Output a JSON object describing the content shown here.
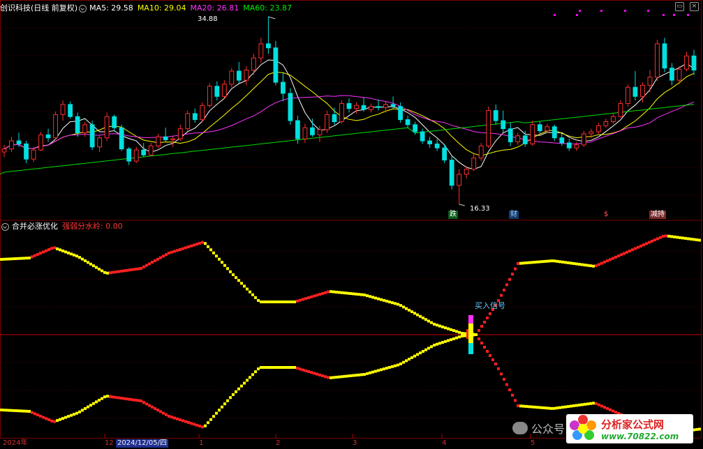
{
  "header": {
    "stock_title": "创识科技(日线 前复权)",
    "ma5": "MA5: 29.58",
    "ma10": "MA10: 29.04",
    "ma20": "MA20: 26.81",
    "ma60": "MA60: 23.87",
    "colors": {
      "ma5": "#ffffff",
      "ma10": "#ffff00",
      "ma20": "#ff33ff",
      "ma60": "#00e000"
    }
  },
  "price_labels": {
    "high": "34.88",
    "low": "16.33"
  },
  "event_badges": [
    "跌",
    "财",
    "$",
    "减持"
  ],
  "indicator": {
    "name": "合并必涨优化",
    "param": "强弱分水岭: 0.00",
    "buy_signal": "买入信号"
  },
  "xaxis": {
    "labels": [
      "2024年",
      "12",
      "1",
      "2",
      "3",
      "4",
      "5"
    ],
    "cursor_date": "2024/12/05/四"
  },
  "watermark": {
    "wechat": "公众号",
    "site_title": "分析家公式网",
    "site_url": "www.70822.com"
  },
  "chart_data": {
    "type": "candlestick",
    "candles": [
      [
        21.5,
        22.2,
        21.0,
        21.8
      ],
      [
        21.8,
        23.0,
        21.5,
        22.6
      ],
      [
        22.6,
        23.4,
        22.0,
        22.3
      ],
      [
        22.3,
        22.6,
        20.4,
        20.8
      ],
      [
        20.8,
        22.0,
        20.5,
        21.7
      ],
      [
        21.7,
        23.5,
        21.6,
        23.2
      ],
      [
        23.2,
        23.8,
        22.5,
        22.9
      ],
      [
        22.9,
        25.5,
        22.7,
        25.2
      ],
      [
        25.2,
        26.6,
        24.6,
        26.2
      ],
      [
        26.2,
        26.5,
        24.8,
        25.0
      ],
      [
        25.0,
        25.4,
        23.0,
        23.4
      ],
      [
        23.4,
        24.5,
        23.0,
        24.2
      ],
      [
        24.2,
        24.6,
        21.7,
        22.0
      ],
      [
        22.0,
        23.2,
        21.5,
        22.9
      ],
      [
        22.9,
        25.4,
        22.6,
        25.0
      ],
      [
        25.0,
        25.2,
        23.6,
        23.9
      ],
      [
        23.9,
        24.2,
        21.6,
        21.8
      ],
      [
        21.8,
        22.0,
        20.2,
        20.6
      ],
      [
        20.6,
        22.0,
        20.4,
        21.7
      ],
      [
        21.7,
        22.4,
        21.0,
        21.2
      ],
      [
        21.2,
        22.4,
        21.1,
        22.1
      ],
      [
        22.1,
        23.3,
        21.9,
        23.0
      ],
      [
        23.0,
        23.9,
        22.5,
        22.7
      ],
      [
        22.7,
        23.1,
        22.0,
        22.8
      ],
      [
        22.8,
        24.2,
        22.6,
        23.8
      ],
      [
        23.8,
        25.6,
        23.6,
        25.3
      ],
      [
        25.3,
        25.8,
        24.4,
        24.7
      ],
      [
        24.7,
        26.4,
        24.5,
        26.1
      ],
      [
        26.1,
        28.3,
        25.9,
        28.0
      ],
      [
        28.0,
        28.5,
        26.6,
        27.0
      ],
      [
        27.0,
        28.6,
        26.8,
        28.2
      ],
      [
        28.2,
        29.8,
        27.9,
        29.5
      ],
      [
        29.5,
        30.4,
        28.3,
        28.6
      ],
      [
        28.6,
        30.0,
        28.1,
        29.6
      ],
      [
        29.6,
        31.2,
        29.1,
        30.8
      ],
      [
        30.8,
        32.8,
        30.3,
        32.2
      ],
      [
        32.2,
        34.88,
        31.2,
        31.8
      ],
      [
        31.8,
        32.5,
        28.1,
        28.4
      ],
      [
        28.4,
        29.3,
        26.5,
        27.3
      ],
      [
        27.3,
        27.8,
        24.2,
        24.6
      ],
      [
        24.6,
        25.1,
        22.3,
        22.8
      ],
      [
        22.8,
        24.3,
        22.4,
        23.9
      ],
      [
        23.9,
        24.8,
        23.0,
        23.2
      ],
      [
        23.2,
        24.1,
        22.5,
        23.7
      ],
      [
        23.7,
        25.6,
        23.4,
        25.2
      ],
      [
        25.2,
        25.9,
        24.2,
        24.5
      ],
      [
        24.5,
        26.6,
        24.3,
        26.3
      ],
      [
        26.3,
        26.8,
        25.4,
        25.8
      ],
      [
        25.8,
        26.4,
        25.3,
        26.1
      ],
      [
        26.1,
        26.9,
        25.5,
        25.7
      ],
      [
        25.7,
        26.3,
        25.4,
        26.0
      ],
      [
        26.0,
        26.7,
        25.6,
        25.9
      ],
      [
        25.9,
        26.5,
        25.4,
        26.2
      ],
      [
        26.2,
        27.0,
        25.8,
        26.0
      ],
      [
        26.0,
        26.4,
        24.4,
        24.7
      ],
      [
        24.7,
        25.1,
        23.9,
        24.2
      ],
      [
        24.2,
        24.5,
        23.2,
        23.5
      ],
      [
        23.5,
        23.8,
        22.3,
        22.6
      ],
      [
        22.6,
        23.0,
        21.9,
        22.3
      ],
      [
        22.3,
        22.8,
        21.6,
        21.9
      ],
      [
        21.9,
        22.3,
        20.4,
        20.7
      ],
      [
        20.7,
        21.1,
        17.8,
        18.2
      ],
      [
        18.2,
        19.8,
        16.33,
        19.3
      ],
      [
        19.3,
        20.1,
        18.9,
        19.8
      ],
      [
        19.8,
        21.3,
        19.6,
        20.9
      ],
      [
        20.9,
        22.4,
        20.6,
        22.1
      ],
      [
        22.1,
        26.0,
        21.9,
        25.6
      ],
      [
        25.6,
        26.2,
        24.2,
        24.6
      ],
      [
        24.6,
        25.6,
        23.4,
        23.8
      ],
      [
        23.8,
        24.4,
        22.1,
        22.5
      ],
      [
        22.5,
        23.4,
        22.2,
        23.1
      ],
      [
        23.1,
        23.6,
        22.0,
        22.3
      ],
      [
        22.3,
        24.6,
        22.1,
        24.2
      ],
      [
        24.2,
        24.5,
        23.3,
        23.6
      ],
      [
        23.6,
        24.3,
        23.4,
        24.0
      ],
      [
        24.0,
        24.2,
        22.6,
        22.9
      ],
      [
        22.9,
        23.3,
        22.1,
        22.4
      ],
      [
        22.4,
        22.8,
        21.6,
        21.9
      ],
      [
        21.9,
        22.5,
        21.6,
        22.2
      ],
      [
        22.2,
        23.6,
        22.0,
        23.3
      ],
      [
        23.3,
        23.8,
        22.9,
        23.5
      ],
      [
        23.5,
        24.4,
        23.3,
        24.1
      ],
      [
        24.1,
        24.8,
        23.9,
        24.5
      ],
      [
        24.5,
        25.3,
        24.3,
        25.0
      ],
      [
        25.0,
        26.6,
        24.9,
        26.3
      ],
      [
        26.3,
        28.2,
        26.0,
        27.9
      ],
      [
        27.9,
        29.5,
        26.6,
        27.0
      ],
      [
        27.0,
        28.4,
        26.4,
        28.1
      ],
      [
        28.1,
        29.6,
        27.4,
        28.9
      ],
      [
        28.9,
        32.6,
        28.5,
        32.2
      ],
      [
        32.2,
        32.8,
        29.4,
        29.8
      ],
      [
        29.8,
        30.3,
        28.1,
        28.6
      ],
      [
        28.6,
        30.0,
        28.2,
        29.7
      ],
      [
        29.7,
        31.4,
        29.5,
        31.0
      ],
      [
        31.0,
        31.6,
        29.1,
        29.6
      ]
    ],
    "ylim": [
      15.5,
      35.5
    ],
    "ma_labels": [
      "MA5",
      "MA10",
      "MA20",
      "MA60"
    ],
    "indicator_threshold": 0.0
  }
}
